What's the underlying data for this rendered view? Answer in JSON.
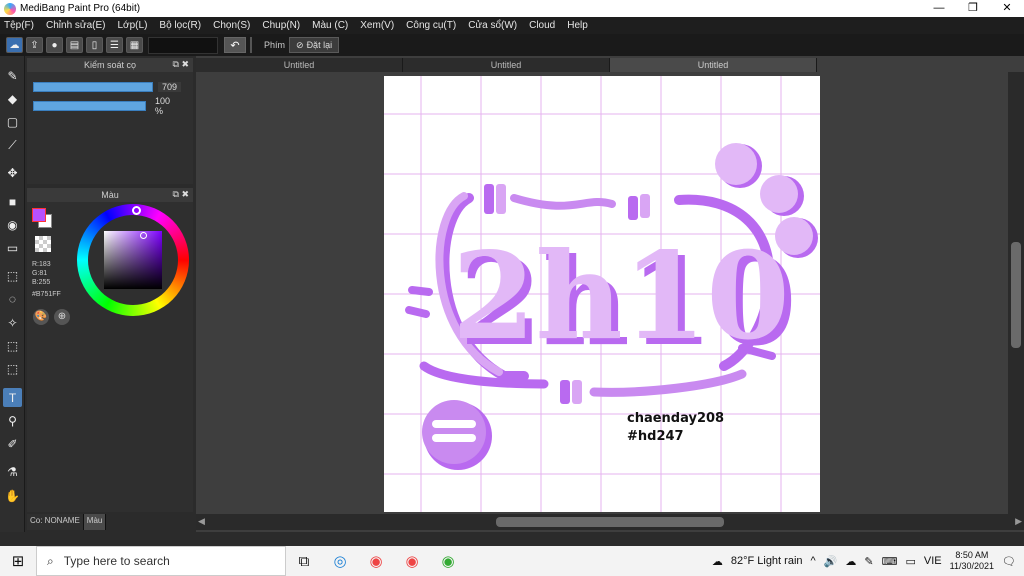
{
  "window": {
    "title": "MediBang Paint Pro (64bit)",
    "minimize": "—",
    "maximize": "❐",
    "close": "✕"
  },
  "menu": [
    "Tệp(F)",
    "Chỉnh sửa(E)",
    "Lớp(L)",
    "Bộ lọc(R)",
    "Chọn(S)",
    "Chup(N)",
    "Màu (C)",
    "Xem(V)",
    "Công cụ(T)",
    "Cửa sổ(W)",
    "Cloud",
    "Help"
  ],
  "toolbar": {
    "phim_label": "Phím",
    "reset_label": "Đặt lại"
  },
  "brush_panel": {
    "title": "Kiểm soát cọ",
    "size_value": "709",
    "opacity_value": "100 %"
  },
  "color_panel": {
    "title": "Màu",
    "r": "R:183",
    "g": "G:81",
    "b": "B:255",
    "hex": "#B751FF",
    "current_color": "#B751FF"
  },
  "tabs": [
    "Untitled",
    "Untitled",
    "Untitled"
  ],
  "canvas_text": {
    "line1": "chaenday208",
    "line2": "#hd247",
    "lettering": "2h10"
  },
  "bottom_tabs": [
    "Co: NONAME",
    "Màu"
  ],
  "taskbar": {
    "search_placeholder": "Type here to search",
    "weather": "82°F  Light rain",
    "lang": "VIE",
    "time": "8:50 AM",
    "date": "11/30/2021"
  }
}
